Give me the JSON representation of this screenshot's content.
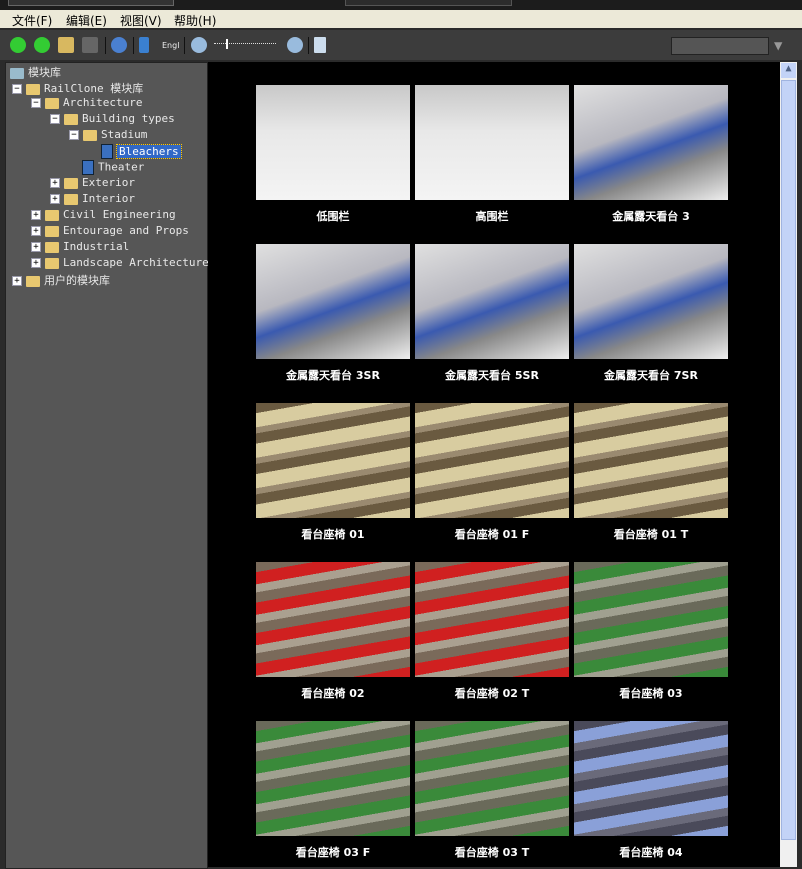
{
  "menu": [
    "文件(F)",
    "编辑(E)",
    "视图(V)",
    "帮助(H)"
  ],
  "toolbar": {
    "lang_label": "Engl",
    "icons": [
      "back-icon",
      "forward-icon",
      "open-folder-icon",
      "save-icon",
      "refresh-icon",
      "sort-icon",
      "zoom-out-icon",
      "zoom-slider",
      "zoom-in-icon",
      "checklist-icon",
      "filter-icon"
    ]
  },
  "tree": [
    {
      "label": "模块库",
      "level": 0,
      "icon": "library",
      "exp": ""
    },
    {
      "label": "RailClone 模块库",
      "level": 0,
      "icon": "folder",
      "exp": "-"
    },
    {
      "label": "Architecture",
      "level": 1,
      "icon": "folder",
      "exp": "-"
    },
    {
      "label": "Building types",
      "level": 2,
      "icon": "folder",
      "exp": "-"
    },
    {
      "label": "Stadium",
      "level": 3,
      "icon": "folder",
      "exp": "-"
    },
    {
      "label": "Bleachers",
      "level": 4,
      "icon": "book",
      "exp": "",
      "selected": true
    },
    {
      "label": "Theater",
      "level": 3,
      "icon": "book",
      "exp": ""
    },
    {
      "label": "Exterior",
      "level": 2,
      "icon": "folder",
      "exp": "+"
    },
    {
      "label": "Interior",
      "level": 2,
      "icon": "folder",
      "exp": "+"
    },
    {
      "label": "Civil Engineering",
      "level": 1,
      "icon": "folder",
      "exp": "+"
    },
    {
      "label": "Entourage and Props",
      "level": 1,
      "icon": "folder",
      "exp": "+"
    },
    {
      "label": "Industrial",
      "level": 1,
      "icon": "folder",
      "exp": "+"
    },
    {
      "label": "Landscape Architecture",
      "level": 1,
      "icon": "folder",
      "exp": "+"
    },
    {
      "label": "用户的模块库",
      "level": 0,
      "icon": "folder",
      "exp": "+"
    }
  ],
  "items": [
    {
      "label": "低围栏",
      "kind": "rail"
    },
    {
      "label": "高围栏",
      "kind": "rail"
    },
    {
      "label": "金属露天看台 3",
      "kind": "bleacher"
    },
    {
      "label": "金属露天看台 3SR",
      "kind": "bleacher"
    },
    {
      "label": "金属露天看台 5SR",
      "kind": "bleacher"
    },
    {
      "label": "金属露天看台 7SR",
      "kind": "bleacher"
    },
    {
      "label": "看台座椅 01",
      "kind": "beige"
    },
    {
      "label": "看台座椅 01 F",
      "kind": "beige"
    },
    {
      "label": "看台座椅 01 T",
      "kind": "beige"
    },
    {
      "label": "看台座椅 02",
      "kind": "red"
    },
    {
      "label": "看台座椅 02 T",
      "kind": "red"
    },
    {
      "label": "看台座椅 03",
      "kind": "green"
    },
    {
      "label": "看台座椅 03 F",
      "kind": "green"
    },
    {
      "label": "看台座椅 03 T",
      "kind": "green"
    },
    {
      "label": "看台座椅 04",
      "kind": "blue"
    }
  ]
}
